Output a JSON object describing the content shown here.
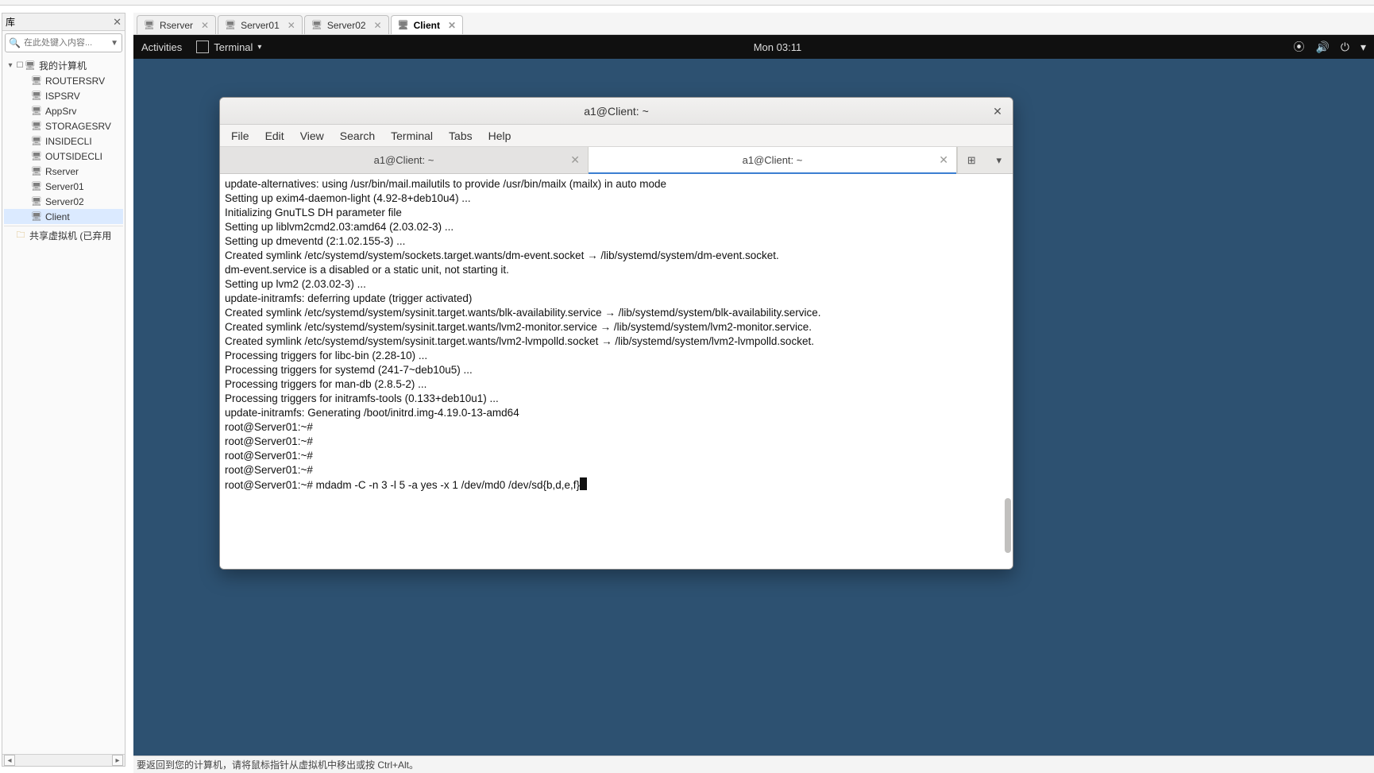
{
  "sidebar": {
    "title": "库",
    "search_placeholder": "在此处键入内容...",
    "root": "我的计算机",
    "nodes": [
      {
        "label": "ROUTERSRV"
      },
      {
        "label": "ISPSRV"
      },
      {
        "label": "AppSrv"
      },
      {
        "label": "STORAGESRV"
      },
      {
        "label": "INSIDECLI"
      },
      {
        "label": "OUTSIDECLI"
      },
      {
        "label": "Rserver"
      },
      {
        "label": "Server01"
      },
      {
        "label": "Server02"
      },
      {
        "label": "Client"
      }
    ],
    "shared": "共享虚拟机 (已弃用"
  },
  "vm_tabs": [
    {
      "label": "Rserver",
      "active": false
    },
    {
      "label": "Server01",
      "active": false
    },
    {
      "label": "Server02",
      "active": false
    },
    {
      "label": "Client",
      "active": true
    }
  ],
  "gnome": {
    "activities": "Activities",
    "app_label": "Terminal",
    "clock": "Mon 03:11"
  },
  "terminal": {
    "window_title": "a1@Client: ~",
    "menu": [
      "File",
      "Edit",
      "View",
      "Search",
      "Terminal",
      "Tabs",
      "Help"
    ],
    "tabs": [
      {
        "label": "a1@Client: ~",
        "active": false
      },
      {
        "label": "a1@Client: ~",
        "active": true
      }
    ],
    "lines": [
      "update-alternatives: using /usr/bin/mail.mailutils to provide /usr/bin/mailx (mailx) in auto mode",
      "Setting up exim4-daemon-light (4.92-8+deb10u4) ...",
      "Initializing GnuTLS DH parameter file",
      "Setting up liblvm2cmd2.03:amd64 (2.03.02-3) ...",
      "Setting up dmeventd (2:1.02.155-3) ...",
      "Created symlink /etc/systemd/system/sockets.target.wants/dm-event.socket → /lib/systemd/system/dm-event.socket.",
      "dm-event.service is a disabled or a static unit, not starting it.",
      "Setting up lvm2 (2.03.02-3) ...",
      "update-initramfs: deferring update (trigger activated)",
      "Created symlink /etc/systemd/system/sysinit.target.wants/blk-availability.service → /lib/systemd/system/blk-availability.service.",
      "Created symlink /etc/systemd/system/sysinit.target.wants/lvm2-monitor.service → /lib/systemd/system/lvm2-monitor.service.",
      "Created symlink /etc/systemd/system/sysinit.target.wants/lvm2-lvmpolld.socket → /lib/systemd/system/lvm2-lvmpolld.socket.",
      "Processing triggers for libc-bin (2.28-10) ...",
      "Processing triggers for systemd (241-7~deb10u5) ...",
      "Processing triggers for man-db (2.8.5-2) ...",
      "Processing triggers for initramfs-tools (0.133+deb10u1) ...",
      "update-initramfs: Generating /boot/initrd.img-4.19.0-13-amd64",
      "root@Server01:~#",
      "root@Server01:~#",
      "root@Server01:~#",
      "root@Server01:~#"
    ],
    "prompt": "root@Server01:~# ",
    "current_command": "mdadm -C -n 3 -l 5 -a yes -x 1 /dev/md0 /dev/sd{b,d,e,f}"
  },
  "statusbar": {
    "hint": "要返回到您的计算机，请将鼠标指针从虚拟机中移出或按 Ctrl+Alt。"
  }
}
